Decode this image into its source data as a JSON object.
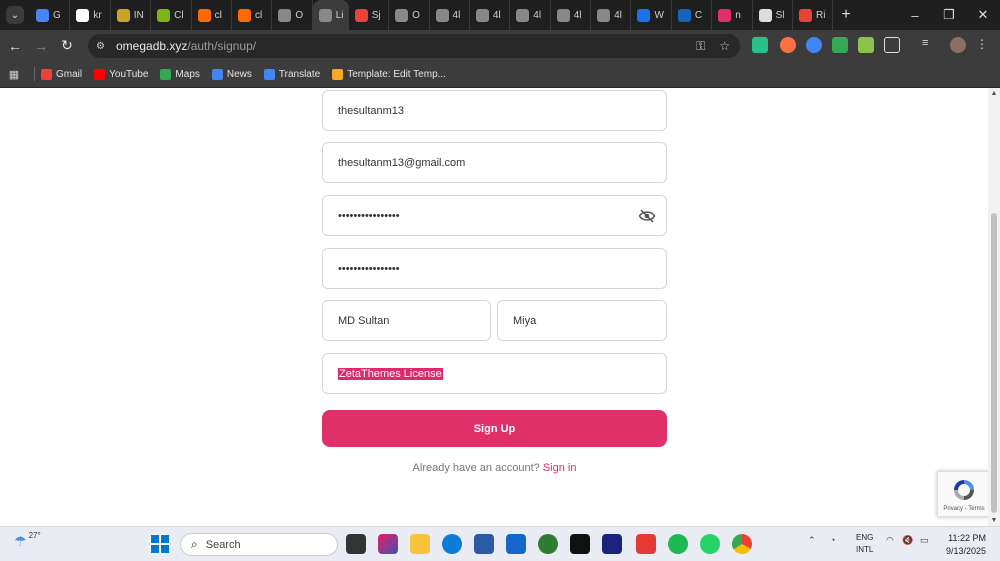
{
  "browser": {
    "tabs": [
      {
        "label": "G",
        "icon": "google-translate-icon",
        "color": "#4285f4"
      },
      {
        "label": "kr",
        "icon": "google-icon",
        "color": "#ffffff"
      },
      {
        "label": "IN",
        "icon": "site-icon",
        "color": "#c9a227"
      },
      {
        "label": "Cl",
        "icon": "site-icon",
        "color": "#7cb518"
      },
      {
        "label": "cl",
        "icon": "site-icon",
        "color": "#ff6a00"
      },
      {
        "label": "cl",
        "icon": "site-icon",
        "color": "#ff6a00"
      },
      {
        "label": "O",
        "icon": "globe-icon",
        "color": "#888888"
      },
      {
        "label": "Li",
        "icon": "site-icon",
        "color": "#888888",
        "active": true
      },
      {
        "label": "Sj",
        "icon": "gmail-icon",
        "color": "#ea4335"
      },
      {
        "label": "O",
        "icon": "globe-icon",
        "color": "#888888"
      },
      {
        "label": "4l",
        "icon": "globe-icon",
        "color": "#888888"
      },
      {
        "label": "4l",
        "icon": "globe-icon",
        "color": "#888888"
      },
      {
        "label": "4l",
        "icon": "globe-icon",
        "color": "#888888"
      },
      {
        "label": "4l",
        "icon": "globe-icon",
        "color": "#888888"
      },
      {
        "label": "4l",
        "icon": "globe-icon",
        "color": "#888888"
      },
      {
        "label": "W",
        "icon": "site-icon",
        "color": "#1a73e8"
      },
      {
        "label": "C",
        "icon": "site-icon",
        "color": "#1565c0"
      },
      {
        "label": "n",
        "icon": "site-icon",
        "color": "#e0306a"
      },
      {
        "label": "Sl",
        "icon": "site-icon",
        "color": "#dddddd"
      },
      {
        "label": "Ri",
        "icon": "gmail-icon",
        "color": "#ea4335"
      }
    ],
    "url_domain": "omegadb.xyz",
    "url_path": "/auth/signup/",
    "bookmarks": [
      {
        "label": "Gmail",
        "color": "#ea4335"
      },
      {
        "label": "YouTube",
        "color": "#ff0000"
      },
      {
        "label": "Maps",
        "color": "#34a853"
      },
      {
        "label": "News",
        "color": "#4285f4"
      },
      {
        "label": "Translate",
        "color": "#4285f4"
      },
      {
        "label": "Template: Edit Temp...",
        "color": "#f9a825"
      }
    ]
  },
  "form": {
    "username": "thesultanm13",
    "email": "thesultanm13@gmail.com",
    "password": "••••••••••••••••",
    "confirm_password": "••••••••••••••••",
    "first_name": "MD Sultan",
    "last_name": "Miya",
    "license": "ZetaThemes License",
    "submit_label": "Sign Up",
    "signin_prompt": "Already have an account?",
    "signin_link": "Sign in",
    "accent_color": "#e0306a"
  },
  "recaptcha": {
    "links": "Privacy - Terms"
  },
  "taskbar": {
    "temperature": "27°",
    "search_placeholder": "Search",
    "lang_top": "ENG",
    "lang_bottom": "INTL",
    "time": "11:22 PM",
    "date": "9/13/2025"
  }
}
